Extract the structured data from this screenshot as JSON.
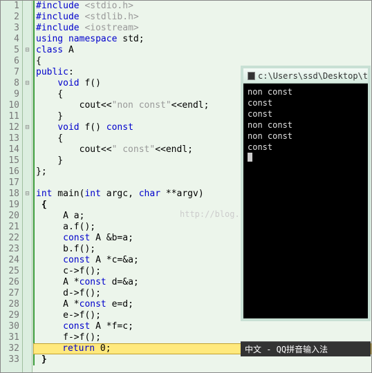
{
  "editor": {
    "lines": [
      {
        "n": 1,
        "fold": "",
        "html": "<span class='pp'>#include</span> <span class='inc'>&lt;stdio.h&gt;</span>"
      },
      {
        "n": 2,
        "fold": "",
        "html": "<span class='pp'>#include</span> <span class='inc'>&lt;stdlib.h&gt;</span>"
      },
      {
        "n": 3,
        "fold": "",
        "html": "<span class='pp'>#include</span> <span class='inc'>&lt;iostream&gt;</span>"
      },
      {
        "n": 4,
        "fold": "",
        "html": "<span class='kw'>using</span> <span class='kw'>namespace</span> std;"
      },
      {
        "n": 5,
        "fold": "⊟",
        "html": "<span class='kw'>class</span> A"
      },
      {
        "n": 6,
        "fold": "",
        "html": "{"
      },
      {
        "n": 7,
        "fold": "",
        "html": "<span class='kw'>public</span>:"
      },
      {
        "n": 8,
        "fold": "⊟",
        "html": "    <span class='kw'>void</span> f()"
      },
      {
        "n": 9,
        "fold": "",
        "html": "    {"
      },
      {
        "n": 10,
        "fold": "",
        "html": "        cout&lt;&lt;<span class='str'>\"non const\"</span>&lt;&lt;endl;"
      },
      {
        "n": 11,
        "fold": "",
        "html": "    }"
      },
      {
        "n": 12,
        "fold": "⊟",
        "html": "    <span class='kw'>void</span> f() <span class='kw'>const</span>"
      },
      {
        "n": 13,
        "fold": "",
        "html": "    {"
      },
      {
        "n": 14,
        "fold": "",
        "html": "        cout&lt;&lt;<span class='str'>\" const\"</span>&lt;&lt;endl;"
      },
      {
        "n": 15,
        "fold": "",
        "html": "    }"
      },
      {
        "n": 16,
        "fold": "",
        "html": "};"
      },
      {
        "n": 17,
        "fold": "",
        "html": ""
      },
      {
        "n": 18,
        "fold": "⊟",
        "html": "<span class='kw'>int</span> main(<span class='kw'>int</span> argc, <span class='kw'>char</span> **argv)"
      },
      {
        "n": 19,
        "fold": "",
        "html": " <b>{</b>"
      },
      {
        "n": 20,
        "fold": "",
        "html": "     A a;"
      },
      {
        "n": 21,
        "fold": "",
        "html": "     a.f();"
      },
      {
        "n": 22,
        "fold": "",
        "html": "     <span class='kw'>const</span> A &amp;b=a;"
      },
      {
        "n": 23,
        "fold": "",
        "html": "     b.f();"
      },
      {
        "n": 24,
        "fold": "",
        "html": "     <span class='kw'>const</span> A *c=&amp;a;"
      },
      {
        "n": 25,
        "fold": "",
        "html": "     c-&gt;f();"
      },
      {
        "n": 26,
        "fold": "",
        "html": "     A *<span class='kw'>const</span> d=&amp;a;"
      },
      {
        "n": 27,
        "fold": "",
        "html": "     d-&gt;f();"
      },
      {
        "n": 28,
        "fold": "",
        "html": "     A *<span class='kw'>const</span> e=d;"
      },
      {
        "n": 29,
        "fold": "",
        "html": "     e-&gt;f();"
      },
      {
        "n": 30,
        "fold": "",
        "html": "     <span class='kw'>const</span> A *f=c;"
      },
      {
        "n": 31,
        "fold": "",
        "html": "     f-&gt;f();"
      },
      {
        "n": 32,
        "fold": "",
        "html": "     <span class='kw'>return</span> 0;",
        "hl": true
      },
      {
        "n": 33,
        "fold": "",
        "html": " <b>}</b>"
      }
    ]
  },
  "console": {
    "title": "c:\\Users\\ssd\\Desktop\\t",
    "output": [
      "non const",
      " const",
      " const",
      "non const",
      "non const",
      " const"
    ]
  },
  "ime": {
    "text": "中文 - QQ拼音输入法"
  },
  "watermark": "http://blog.csdn.net"
}
